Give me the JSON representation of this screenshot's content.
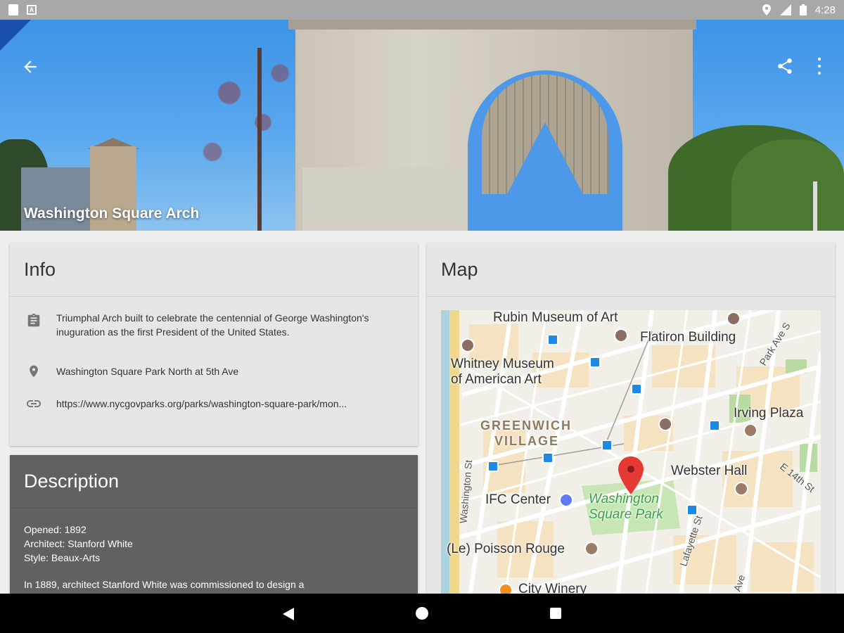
{
  "status_bar": {
    "time": "4:28"
  },
  "hero": {
    "title": "Washington Square Arch"
  },
  "info": {
    "heading": "Info",
    "description": "Triumphal Arch built to celebrate the centennial of George Washington's inuguration as the first President of the United States.",
    "address": "Washington Square Park North at 5th Ave",
    "link": "https://www.nycgovparks.org/parks/washington-square-park/mon..."
  },
  "description": {
    "heading": "Description",
    "opened": "Opened: 1892",
    "architect": "Architect: Stanford White",
    "style": "Style: Beaux-Arts",
    "body": "In 1889, architect Stanford White was commissioned to design a"
  },
  "map": {
    "heading": "Map",
    "labels": {
      "rubin": "Rubin Museum of Art",
      "flatiron": "Flatiron Building",
      "whitney_1": "Whitney Museum",
      "whitney_2": "of American Art",
      "greenwich_1": "GREENWICH",
      "greenwich_2": "VILLAGE",
      "irving": "Irving Plaza",
      "webster": "Webster Hall",
      "ifc": "IFC Center",
      "park_1": "Washington",
      "park_2": "Square Park",
      "poisson": "(Le) Poisson Rouge",
      "city_winery": "City Winery",
      "park_ave": "Park Ave S",
      "e14": "E 14th St",
      "washington_st": "Washington St",
      "lafayette": "Lafayette St",
      "ave": "Ave"
    }
  },
  "icons": {
    "back": "arrow-back-icon",
    "share": "share-icon",
    "more": "more-vert-icon",
    "clipboard": "clipboard-icon",
    "location": "location-pin-icon",
    "link": "link-icon"
  },
  "colors": {
    "status_bar": "#a8a8a8",
    "card": "#e6e6e6",
    "description_card": "#616161",
    "nav_bar": "#000000",
    "map_pin": "#e53935"
  }
}
